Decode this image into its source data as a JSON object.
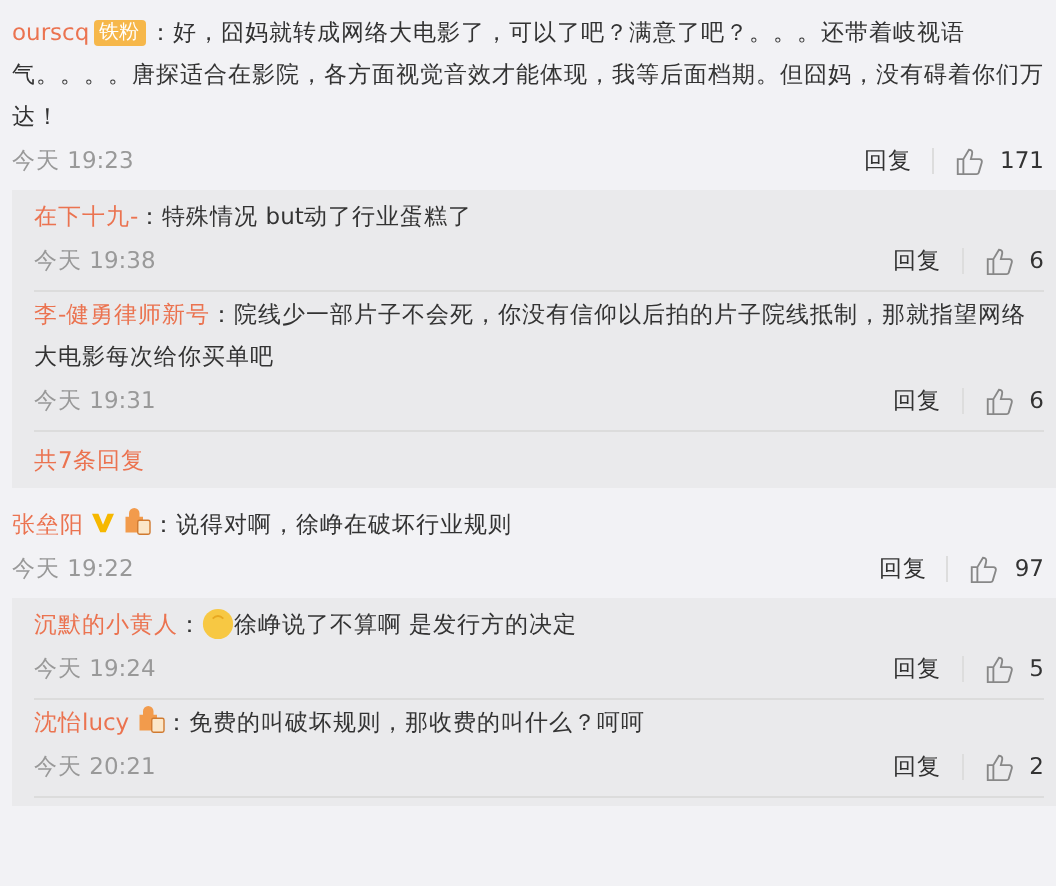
{
  "comments": [
    {
      "user": "ourscq",
      "badges": [
        {
          "kind": "fan",
          "label": "铁粉"
        }
      ],
      "text": "：好，囧妈就转成网络大电影了，可以了吧？满意了吧？。。。还带着岐视语气。。。。唐探适合在影院，各方面视觉音效才能体现，我等后面档期。但囧妈，没有碍着你们万达！",
      "time": "今天 19:23",
      "reply": "回复",
      "likes": "171",
      "replies": [
        {
          "user": "在下十九-",
          "emoji": false,
          "text": "：特殊情况 but动了行业蛋糕了",
          "time": "今天 19:38",
          "reply": "回复",
          "likes": "6"
        },
        {
          "user": "李-健勇律师新号",
          "emoji": false,
          "text": "：院线少一部片子不会死，你没有信仰以后拍的片子院线抵制，那就指望网络大电影每次给你买单吧",
          "time": "今天 19:31",
          "reply": "回复",
          "likes": "6"
        }
      ],
      "more": "共7条回复"
    },
    {
      "user": "张垒阳",
      "badges": [
        {
          "kind": "verified"
        },
        {
          "kind": "level"
        }
      ],
      "text": "：说得对啊，徐峥在破坏行业规则",
      "time": "今天 19:22",
      "reply": "回复",
      "likes": "97",
      "replies": [
        {
          "user": "沉默的小黄人",
          "emoji": true,
          "colon": "：",
          "text": "徐峥说了不算啊 是发行方的决定",
          "time": "今天 19:24",
          "reply": "回复",
          "likes": "5"
        },
        {
          "user": "沈怡lucy",
          "badges": [
            {
              "kind": "level"
            }
          ],
          "emoji": false,
          "text": "：免费的叫破坏规则，那收费的叫什么？呵呵",
          "time": "今天 20:21",
          "reply": "回复",
          "likes": "2"
        }
      ]
    }
  ]
}
